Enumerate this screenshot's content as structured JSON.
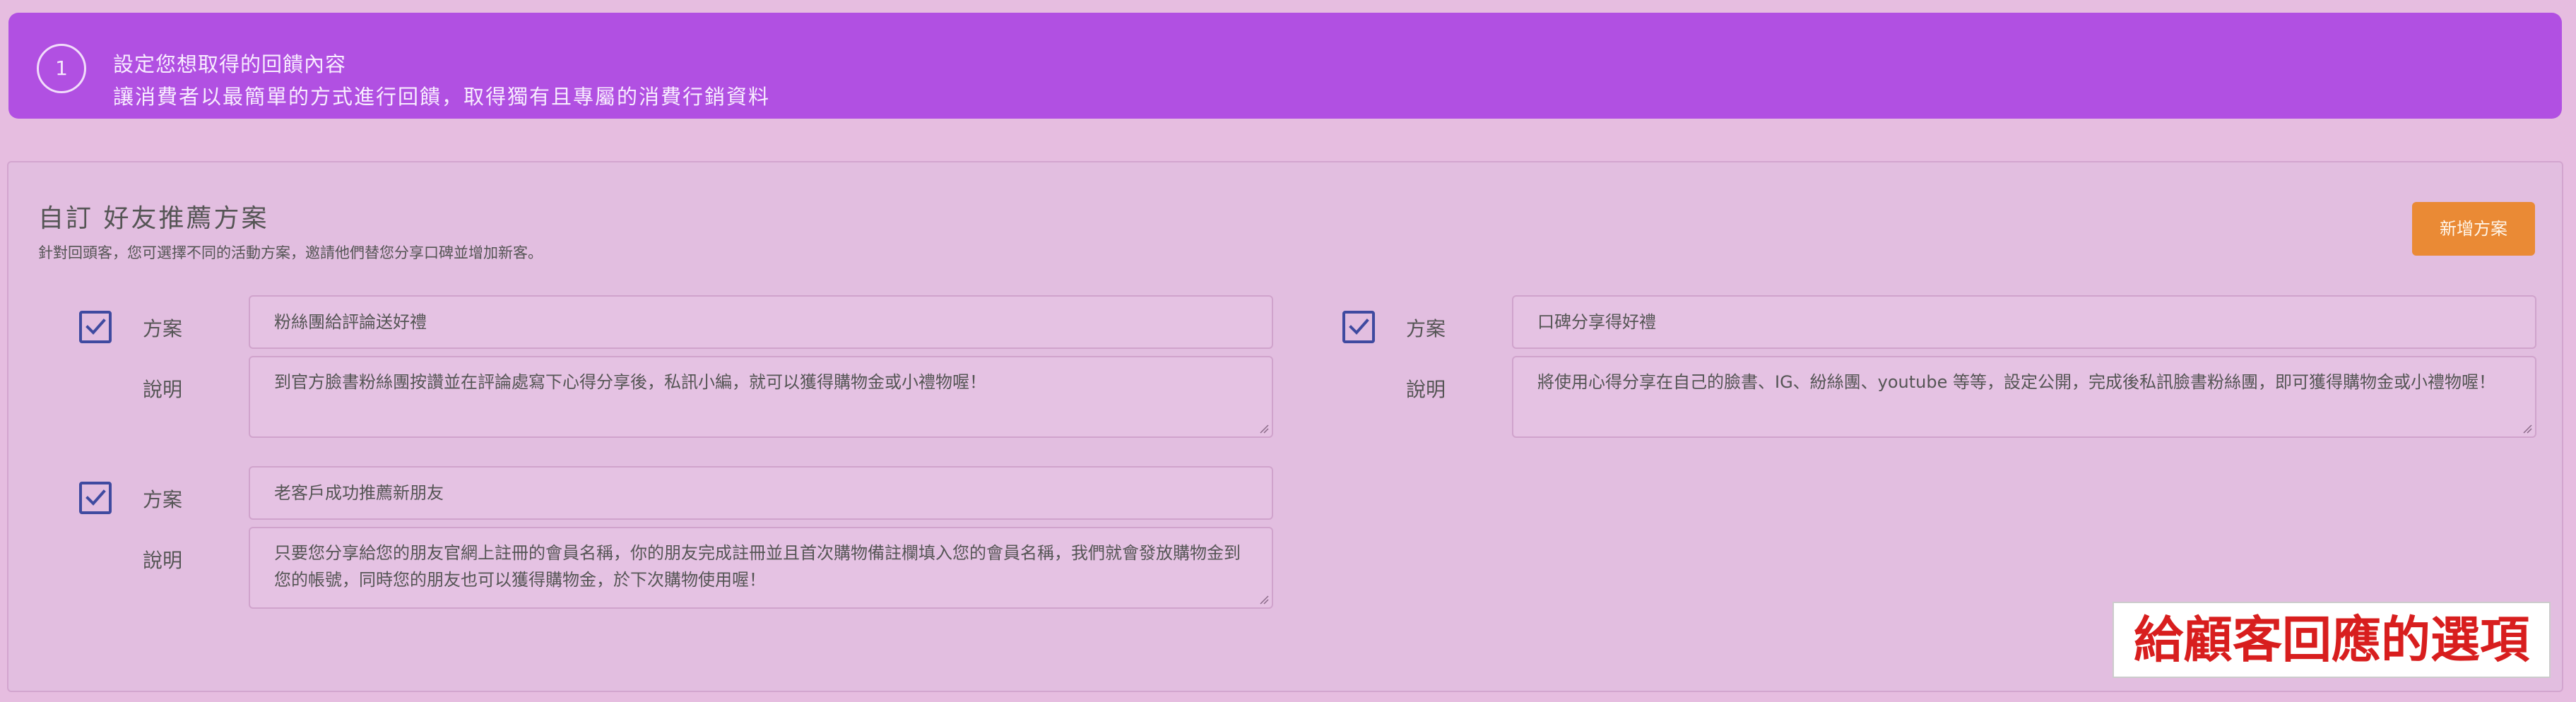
{
  "step": {
    "number": "1",
    "title": "設定您想取得的回饋內容",
    "subtitle": "讓消費者以最簡單的方式進行回饋，取得獨有且專屬的消費行銷資料"
  },
  "panel": {
    "title": "自訂 好友推薦方案",
    "description": "針對回頭客，您可選擇不同的活動方案，邀請他們替您分享口碑並增加新客。",
    "add_button_label": "新增方案"
  },
  "labels": {
    "plan": "方案",
    "description": "說明"
  },
  "plans": [
    {
      "checked": true,
      "name": "粉絲團給評論送好禮",
      "description": "到官方臉書粉絲團按讚並在評論處寫下心得分享後，私訊小編，就可以獲得購物金或小禮物喔！"
    },
    {
      "checked": true,
      "name": "口碑分享得好禮",
      "description": "將使用心得分享在自己的臉書、IG、紛絲團、youtube 等等，設定公開，完成後私訊臉書粉絲團，即可獲得購物金或小禮物喔！"
    },
    {
      "checked": true,
      "name": "老客戶成功推薦新朋友",
      "description": "只要您分享給您的朋友官網上註冊的會員名稱，你的朋友完成註冊並且首次購物備註欄填入您的會員名稱，我們就會發放購物金到您的帳號，同時您的朋友也可以獲得購物金，於下次購物使用喔！"
    }
  ],
  "callout": {
    "text": "給顧客回應的選項"
  },
  "colors": {
    "banner": "#b150e2",
    "background": "#e6bde0",
    "accent_button": "#ea8a35",
    "checkbox": "#3f4aa0",
    "callout_text": "#d81e1e"
  }
}
